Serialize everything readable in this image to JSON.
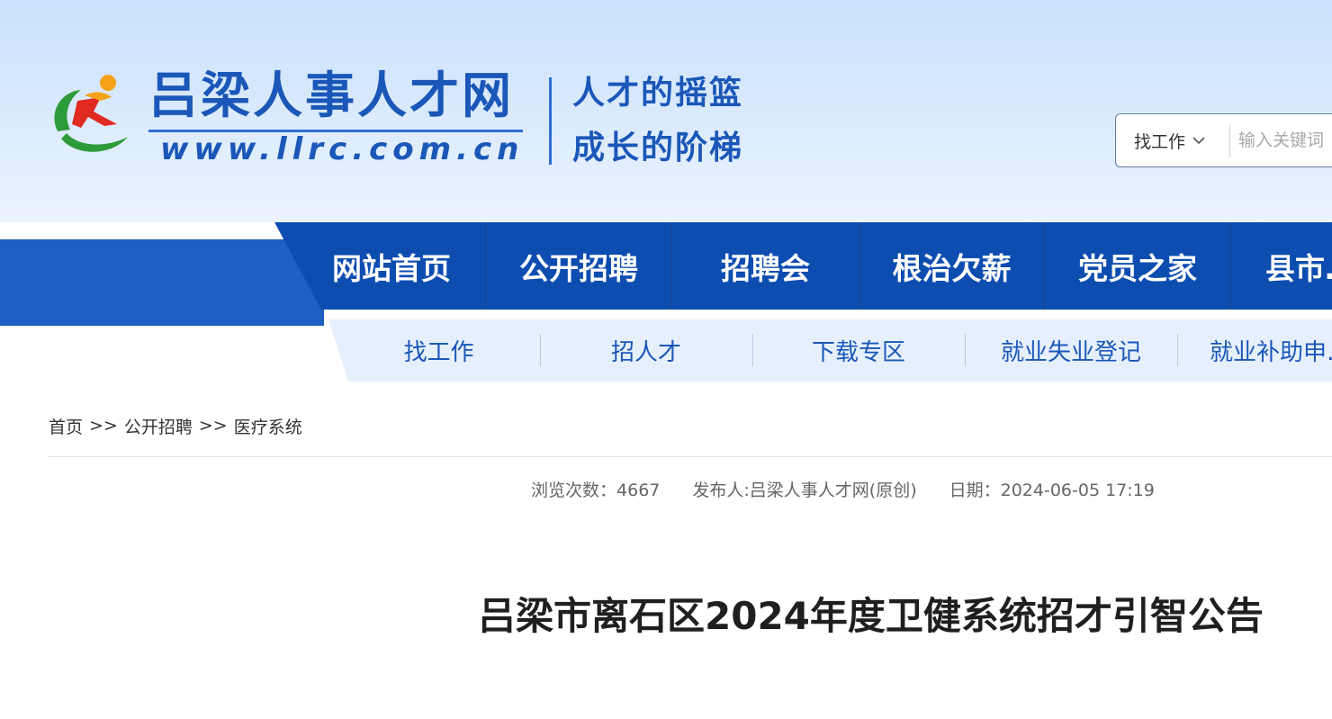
{
  "site": {
    "name": "吕梁人事人才网",
    "url": "www.llrc.com.cn",
    "slogan_1": "人才的摇篮",
    "slogan_2": "成长的阶梯"
  },
  "search": {
    "category": "找工作",
    "placeholder": "输入关键词",
    "icon": "chevron-down-icon"
  },
  "main_nav": [
    {
      "label": "网站首页"
    },
    {
      "label": "公开招聘"
    },
    {
      "label": "招聘会"
    },
    {
      "label": "根治欠薪"
    },
    {
      "label": "党员之家"
    },
    {
      "label": "县市…"
    }
  ],
  "sub_nav": [
    {
      "label": "找工作"
    },
    {
      "label": "招人才"
    },
    {
      "label": "下载专区"
    },
    {
      "label": "就业失业登记"
    },
    {
      "label": "就业补助申…"
    }
  ],
  "breadcrumb": {
    "items": [
      "首页",
      "公开招聘",
      "医疗系统"
    ],
    "separator": ">>"
  },
  "article": {
    "views_label": "浏览次数：",
    "views": "4667",
    "publisher": "发布人:吕梁人事人才网(原创)",
    "date_label": "日期：",
    "date": "2024-06-05 17:19",
    "title": "吕梁市离石区2024年度卫健系统招才引智公告"
  },
  "colors": {
    "brand_blue": "#1a57b8",
    "nav_blue": "#0d4db0",
    "subnav_bg": "#e6f0fc"
  }
}
